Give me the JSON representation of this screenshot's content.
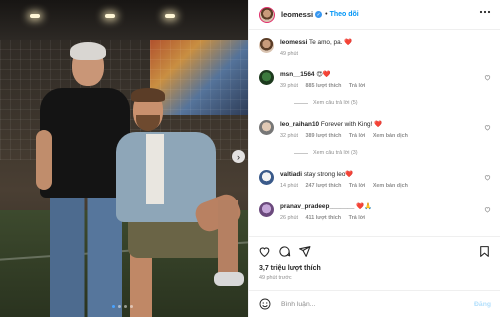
{
  "post": {
    "author": "leomessi",
    "verified_badge": "✓",
    "follow_label": "Theo dõi",
    "more_icon": "more-icon"
  },
  "caption": {
    "username": "leomessi",
    "text": "Te amo, pa. ❤️",
    "time": "49 phút"
  },
  "comments": [
    {
      "username": "msn__1564",
      "text": "😍❤️",
      "time": "39 phút",
      "likes": "885 lượt thích",
      "reply_label": "Trả lời",
      "view_replies": "Xem câu trả lời (5)"
    },
    {
      "username": "leo_raihan10",
      "text": "Forever with King! ❤️",
      "time": "32 phút",
      "likes": "389 lượt thích",
      "reply_label": "Trả lời",
      "translation_label": "Xem bản dịch",
      "view_replies": "Xem câu trả lời (3)"
    },
    {
      "username": "valtiadi",
      "text": "stay strong leo❤️",
      "time": "14 phút",
      "likes": "247 lượt thích",
      "reply_label": "Trả lời",
      "translation_label": "Xem bản dịch"
    },
    {
      "username": "pranav_pradeep_______",
      "text": "❤️🙏",
      "time": "26 phút",
      "likes": "411 lượt thích",
      "reply_label": "Trả lời"
    }
  ],
  "actions": {
    "likes_count": "3,7 triệu lượt thích",
    "time_ago": "49 phút trước"
  },
  "composer": {
    "placeholder": "Bình luận...",
    "post_label": "Đăng"
  },
  "colors": {
    "accent": "#0095f6",
    "verified": "#3897f0",
    "heart": "#ed4956"
  }
}
